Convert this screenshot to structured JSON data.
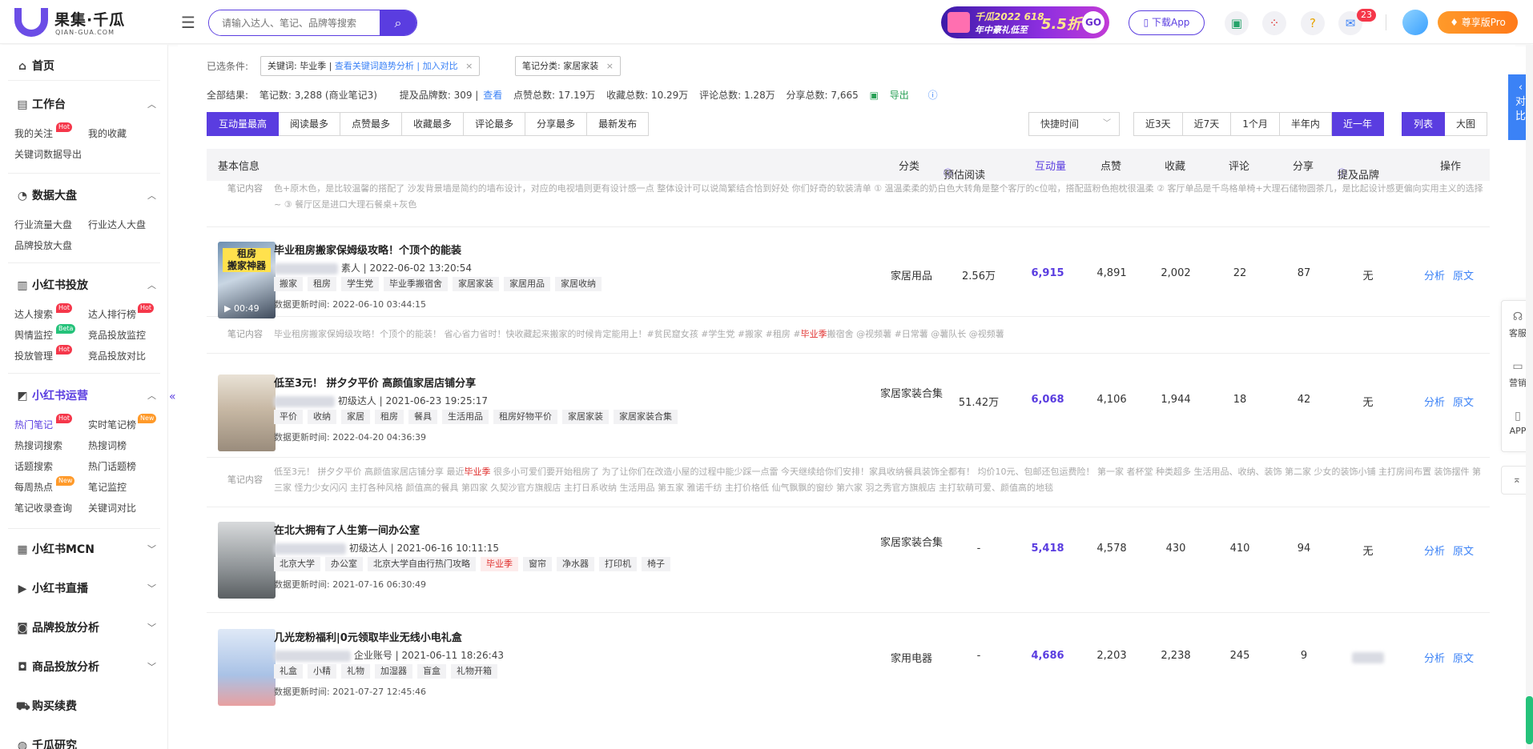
{
  "header": {
    "logo_cn": "果集·千瓜",
    "logo_en": "QIAN-GUA.COM",
    "search_placeholder": "请输入达人、笔记、品牌等搜索",
    "banner_line1": "千瓜2022 618",
    "banner_line2": "年中豪礼低至",
    "banner_discount": "5.5折",
    "banner_go": "GO",
    "download_label": "下载App",
    "message_count": "23",
    "pro_label": "尊享版Pro"
  },
  "sidebar": {
    "home": "首页",
    "workbench": {
      "title": "工作台",
      "items": [
        "我的关注",
        "我的收藏",
        "关键词数据导出"
      ]
    },
    "bigdata": {
      "title": "数据大盘",
      "items": [
        "行业流量大盘",
        "行业达人大盘",
        "品牌投放大盘"
      ]
    },
    "xhs_ads": {
      "title": "小红书投放",
      "items": [
        "达人搜索",
        "达人排行榜",
        "舆情监控",
        "竞品投放监控",
        "投放管理",
        "竞品投放对比"
      ]
    },
    "xhs_ops": {
      "title": "小红书运营",
      "items": [
        "热门笔记",
        "实时笔记榜",
        "热搜词搜索",
        "热搜词榜",
        "话题搜索",
        "热门话题榜",
        "每周热点",
        "笔记监控",
        "笔记收录查询",
        "关键词对比"
      ]
    },
    "mcn": "小红书MCN",
    "live": "小红书直播",
    "brand": "品牌投放分析",
    "goods": "商品投放分析",
    "buy": "购买续费",
    "research": "千瓜研究",
    "tags": {
      "hot": "Hot",
      "new": "New",
      "beta": "Beta"
    }
  },
  "filters": {
    "label": "已选条件:",
    "keyword_chip": "关键词: 毕业季 |",
    "keyword_link": "查看关键词趋势分析 | 加入对比",
    "category_chip": "笔记分类: 家居家装",
    "close": "×"
  },
  "stats": {
    "total_label": "全部结果:",
    "notes": "笔记数: 3,288 (商业笔记3)",
    "brands": "提及品牌数: 309 |",
    "view": "查看",
    "likes": "点赞总数: 17.19万",
    "collects": "收藏总数: 10.29万",
    "comments": "评论总数: 1.28万",
    "shares": "分享总数: 7,665",
    "export": "导出"
  },
  "sort_tabs": [
    "互动量最高",
    "阅读最多",
    "点赞最多",
    "收藏最多",
    "评论最多",
    "分享最多",
    "最新发布"
  ],
  "quick_time": "快捷时间",
  "range_tabs": [
    "近3天",
    "近7天",
    "1个月",
    "半年内",
    "近一年"
  ],
  "view_tabs": [
    "列表",
    "大图"
  ],
  "table_headers": {
    "basic": "基本信息",
    "category": "分类",
    "est_read": "预估阅读",
    "interaction": "互动量",
    "likes": "点赞",
    "collects": "收藏",
    "comments": "评论",
    "shares": "分享",
    "brand": "提及品牌",
    "ops": "操作"
  },
  "top_note": {
    "label": "笔记内容",
    "text": "色+原木色，是比较温馨的搭配了 沙发背景墙是简约的墙布设计，对应的电视墙则更有设计感一点 整体设计可以说简繁结合恰到好处 你们好奇的软装清单 ① 温温柔柔的奶白色大转角是整个客厅的c位啦，搭配蓝粉色抱枕很温柔 ② 客厅单品是千鸟格单椅+大理石储物圆茶几，是比起设计感更偏向实用主义的选择~ ③ 餐厅区是进口大理石餐桌+灰色"
  },
  "rows": [
    {
      "title": "毕业租房搬家保姆级攻略！个顶个的能装",
      "author_level": "素人",
      "publish_time": "2022-06-02 13:20:54",
      "tags": [
        "搬家",
        "租房",
        "学生党",
        "毕业季搬宿舍",
        "家居家装",
        "家居用品",
        "家居收纳"
      ],
      "update_label": "数据更新时间:",
      "update_time": "2022-06-10 03:44:15",
      "video_duration": "00:49",
      "category": "家居用品",
      "est_read": "2.56万",
      "interaction": "6,915",
      "likes": "4,891",
      "collects": "2,002",
      "comments": "22",
      "shares": "87",
      "brand": "无",
      "op1": "分析",
      "op2": "原文",
      "note_label": "笔记内容",
      "note_pre": "毕业租房搬家保姆级攻略！个顶个的能装！ 省心省力省时！快收藏起来搬家的时候肯定能用上！#贫民窟女孩 #学生党 #搬家 #租房 #",
      "note_hl": "毕业季",
      "note_post": "搬宿舍 @视频薯 #日常薯 @薯队长 @视频薯"
    },
    {
      "title": "低至3元！ 拼夕夕平价 高颜值家居店铺分享",
      "author_level": "初级达人",
      "publish_time": "2021-06-23 19:25:17",
      "tags": [
        "平价",
        "收纳",
        "家居",
        "租房",
        "餐具",
        "生活用品",
        "租房好物平价",
        "家居家装",
        "家居家装合集"
      ],
      "update_label": "数据更新时间:",
      "update_time": "2022-04-20 04:36:39",
      "category": "家居家装合集",
      "est_read": "51.42万",
      "interaction": "6,068",
      "likes": "4,106",
      "collects": "1,944",
      "comments": "18",
      "shares": "42",
      "brand": "无",
      "op1": "分析",
      "op2": "原文",
      "note_label": "笔记内容",
      "note_pre": "低至3元！ 拼夕夕平价 高颜值家居店铺分享 最近",
      "note_hl": "毕业季",
      "note_post": " 很多小可爱们要开始租房了 为了让你们在改造小屋的过程中能少踩一点雷 今天继续给你们安排！家具收纳餐具装饰全都有！ 均价10元、包邮还包运费险！ 第一家 者杯堂 种类超多 生活用品、收纳、装饰 第二家 少女的装饰小铺 主打房间布置 装饰摆件 第三家 怪力少女闪闪 主打各种风格 颜值高的餐具 第四家 久契沙官方旗舰店 主打日系收纳 生活用品 第五家 雅诺千纺 主打价格低 仙气飘飘的窗纱 第六家 羽之秀官方旗舰店 主打软萌可爱、颜值高的地毯"
    },
    {
      "title": "在北大拥有了人生第一间办公室",
      "author_level": "初级达人",
      "publish_time": "2021-06-16 10:11:15",
      "tags": [
        "北京大学",
        "办公室",
        "北京大学自由行热门攻略",
        "毕业季",
        "窗帘",
        "净水器",
        "打印机",
        "椅子"
      ],
      "update_label": "数据更新时间:",
      "update_time": "2021-07-16 06:30:49",
      "category": "家居家装合集",
      "est_read": "-",
      "interaction": "5,418",
      "likes": "4,578",
      "collects": "430",
      "comments": "410",
      "shares": "94",
      "brand": "无",
      "op1": "分析",
      "op2": "原文"
    },
    {
      "title": "几光宠粉福利|0元领取毕业无线小电礼盒",
      "author_level": "企业账号",
      "publish_time": "2021-06-11 18:26:43",
      "tags": [
        "礼盒",
        "小精",
        "礼物",
        "加湿器",
        "盲盒",
        "礼物开箱"
      ],
      "update_label": "数据更新时间:",
      "update_time": "2021-07-27 12:45:46",
      "category": "家用电器",
      "est_read": "-",
      "interaction": "4,686",
      "likes": "2,203",
      "collects": "2,238",
      "comments": "245",
      "shares": "9",
      "brand": "",
      "op1": "分析",
      "op2": "原文"
    }
  ],
  "dock": {
    "tab": "对比",
    "service": "客服",
    "marketing": "营销",
    "app": "APP"
  },
  "colors": {
    "brand": "#5a3de0",
    "link": "#3b82f6",
    "hot": "#f5374a",
    "new": "#ff9a2a",
    "beta": "#25c27a"
  }
}
